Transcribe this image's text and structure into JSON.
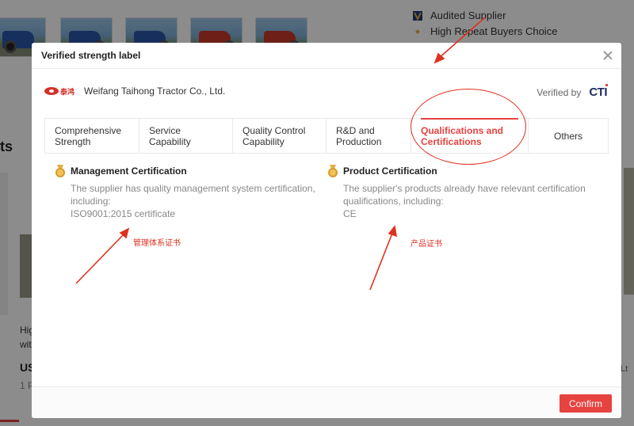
{
  "background": {
    "audit_rows": [
      "Audited Supplier",
      "High Repeat Buyers Choice"
    ],
    "left_heading_fragment": "ts",
    "card_text_line1": "Hig",
    "card_text_line2": "wit",
    "card_price_fragment": "US",
    "card_moq_fragment": "1 P",
    "right_fragment": "Lt"
  },
  "modal": {
    "title": "Verified strength label",
    "company": {
      "logo_text": "泰鸿",
      "name": "Weifang Taihong Tractor Co., Ltd."
    },
    "verified_by_label": "Verified by",
    "verifier_logo": "CTI",
    "tabs": [
      {
        "label": "Comprehensive Strength",
        "active": false
      },
      {
        "label": "Service Capability",
        "active": false
      },
      {
        "label": "Quality Control Capability",
        "active": false
      },
      {
        "label": "R&D and Production",
        "active": false
      },
      {
        "label": "Qualifications and Certifications",
        "active": true
      },
      {
        "label": "Others",
        "active": false
      }
    ],
    "certifications": [
      {
        "title": "Management Certification",
        "description": "The supplier has quality management system certification, including:",
        "item": "ISO9001:2015 certificate",
        "icon": "medal-icon"
      },
      {
        "title": "Product Certification",
        "description": "The supplier's products already have relevant certification qualifications, including:",
        "item": "CE",
        "icon": "medal-icon"
      }
    ],
    "confirm_label": "Confirm"
  },
  "annotations": {
    "left_note": "管理体系证书",
    "right_note": "产品证书",
    "color": "#e03020"
  },
  "colors": {
    "accent": "#e64340",
    "overlay": "rgba(0,0,0,0.45)"
  }
}
